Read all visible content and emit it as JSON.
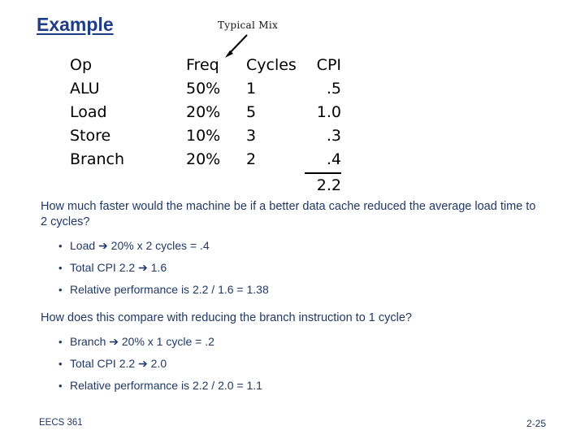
{
  "slide": {
    "title": "Example",
    "colors": {
      "title": "#1F3D86",
      "body": "#1F3864",
      "table_text": "#000000",
      "background": "#FFFFFF"
    }
  },
  "callout": {
    "label": "Typical Mix",
    "arrow_icon": "arrow-down-left-icon"
  },
  "table": {
    "headers": {
      "op": "Op",
      "freq": "Freq",
      "cycles": "Cycles",
      "cpi": "CPI"
    },
    "rows": [
      {
        "op": "ALU",
        "freq": "50%",
        "cycles": "1",
        "cpi": ".5"
      },
      {
        "op": "Load",
        "freq": "20%",
        "cycles": "5",
        "cpi": "1.0"
      },
      {
        "op": "Store",
        "freq": "10%",
        "cycles": "3",
        "cpi": ".3"
      },
      {
        "op": "Branch",
        "freq": "20%",
        "cycles": "2",
        "cpi": ".4"
      }
    ],
    "total_cpi": "2.2"
  },
  "question1": {
    "text": "How much faster would the machine be if a better data cache reduced the average load time to 2 cycles?",
    "bullets": [
      "Load ➔ 20% x 2 cycles = .4",
      "Total CPI 2.2 ➔ 1.6",
      "Relative performance is 2.2 / 1.6 = 1.38"
    ]
  },
  "question2": {
    "text": "How does this compare with reducing the branch instruction to 1 cycle?",
    "bullets": [
      "Branch ➔ 20% x 1 cycle = .2",
      "Total CPI 2.2 ➔ 2.0",
      "Relative performance is 2.2 / 2.0 = 1.1"
    ]
  },
  "footer": {
    "course": "EECS 361",
    "page": "2-25"
  }
}
